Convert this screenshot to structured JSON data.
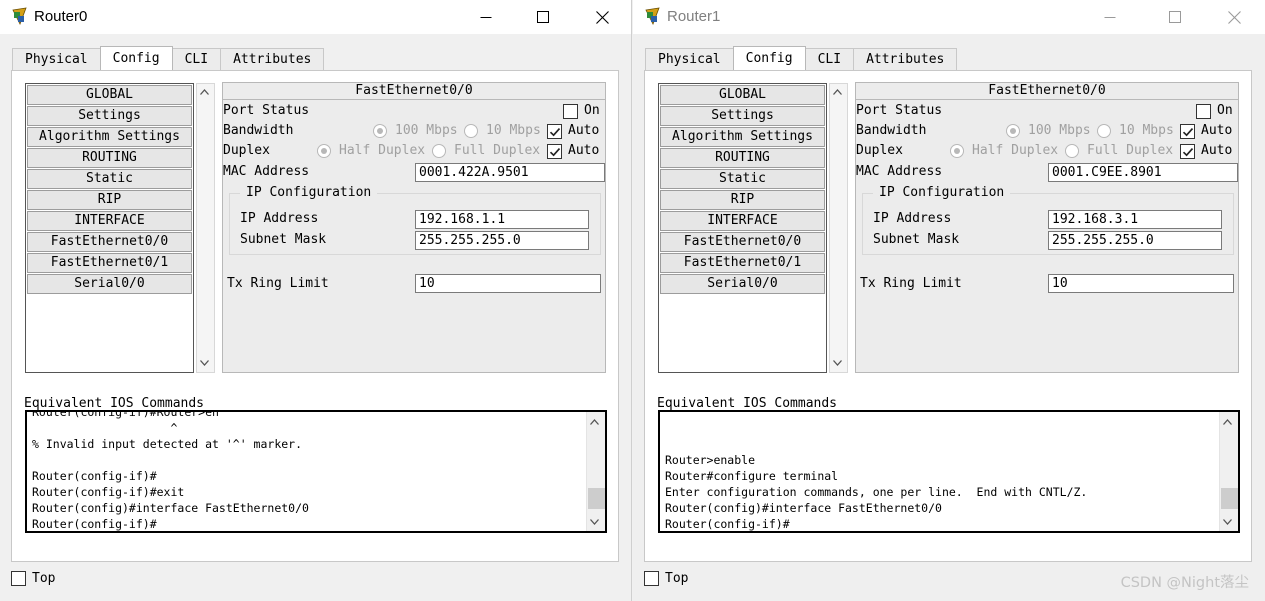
{
  "windows": [
    {
      "title": "Router0",
      "tabs": [
        "Physical",
        "Config",
        "CLI",
        "Attributes"
      ],
      "sidebar": [
        "GLOBAL",
        "Settings",
        "Algorithm Settings",
        "ROUTING",
        "Static",
        "RIP",
        "INTERFACE",
        "FastEthernet0/0",
        "FastEthernet0/1",
        "Serial0/0"
      ],
      "form": {
        "header": "FastEthernet0/0",
        "port_status_label": "Port Status",
        "on_label": "On",
        "bandwidth_label": "Bandwidth",
        "bw_100": "100 Mbps",
        "bw_10": "10 Mbps",
        "auto_label": "Auto",
        "duplex_label": "Duplex",
        "half_duplex": "Half Duplex",
        "full_duplex": "Full Duplex",
        "mac_label": "MAC Address",
        "mac_value": "0001.422A.9501",
        "ip_config_title": "IP Configuration",
        "ip_label": "IP Address",
        "ip_value": "192.168.1.1",
        "mask_label": "Subnet Mask",
        "mask_value": "255.255.255.0",
        "tx_label": "Tx Ring Limit",
        "tx_value": "10"
      },
      "eq_label": "Equivalent IOS Commands",
      "console_lines": [
        "Router(config-if)#Router>en",
        "                    ^",
        "% Invalid input detected at '^' marker.",
        "",
        "Router(config-if)#",
        "Router(config-if)#exit",
        "Router(config)#interface FastEthernet0/0",
        "Router(config-if)#"
      ],
      "top_label": "Top"
    },
    {
      "title": "Router1",
      "tabs": [
        "Physical",
        "Config",
        "CLI",
        "Attributes"
      ],
      "sidebar": [
        "GLOBAL",
        "Settings",
        "Algorithm Settings",
        "ROUTING",
        "Static",
        "RIP",
        "INTERFACE",
        "FastEthernet0/0",
        "FastEthernet0/1",
        "Serial0/0"
      ],
      "form": {
        "header": "FastEthernet0/0",
        "port_status_label": "Port Status",
        "on_label": "On",
        "bandwidth_label": "Bandwidth",
        "bw_100": "100 Mbps",
        "bw_10": "10 Mbps",
        "auto_label": "Auto",
        "duplex_label": "Duplex",
        "half_duplex": "Half Duplex",
        "full_duplex": "Full Duplex",
        "mac_label": "MAC Address",
        "mac_value": "0001.C9EE.8901",
        "ip_config_title": "IP Configuration",
        "ip_label": "IP Address",
        "ip_value": "192.168.3.1",
        "mask_label": "Subnet Mask",
        "mask_value": "255.255.255.0",
        "tx_label": "Tx Ring Limit",
        "tx_value": "10"
      },
      "eq_label": "Equivalent IOS Commands",
      "console_lines": [
        "",
        "",
        "Router>enable",
        "Router#configure terminal",
        "Enter configuration commands, one per line.  End with CNTL/Z.",
        "Router(config)#interface FastEthernet0/0",
        "Router(config-if)#"
      ],
      "top_label": "Top"
    }
  ],
  "watermark": "CSDN @Night落尘",
  "state": {
    "active_tab": "Config",
    "port_on": false,
    "bandwidth_auto": true,
    "duplex_auto": true,
    "top_checked": false
  },
  "colors": {
    "panel_bg": "#ececec",
    "titlebar_bg": "#ffffff",
    "console_border": "#000000"
  }
}
